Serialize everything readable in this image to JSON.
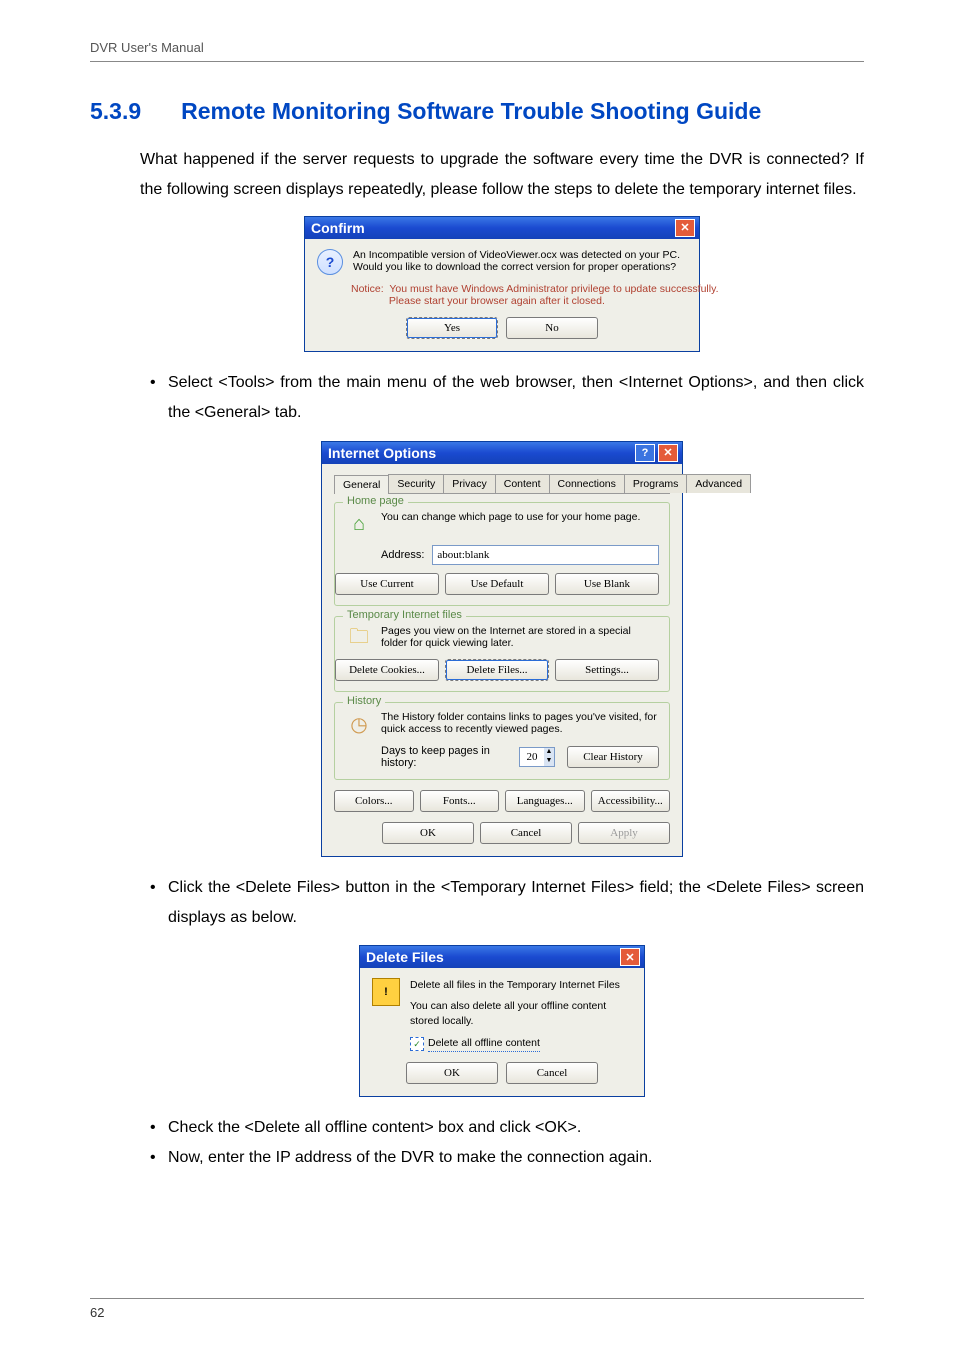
{
  "header": {
    "title": "DVR User's Manual"
  },
  "footer": {
    "page": "62"
  },
  "section": {
    "number": "5.3.9",
    "title": "Remote Monitoring Software Trouble Shooting Guide",
    "intro": "What happened if the server requests to upgrade the software every time the DVR is connected? If the following screen displays repeatedly, please follow the steps to delete the temporary internet files."
  },
  "bullets": {
    "b1": "Select <Tools> from the main menu of the web browser, then <Internet Options>, and then click the <General> tab.",
    "b2": "Click the <Delete Files> button in the <Temporary Internet Files> field; the <Delete Files> screen displays as below.",
    "b3": "Check the <Delete all offline content> box and click <OK>.",
    "b4": "Now, enter the IP address of the DVR to make the connection again."
  },
  "confirm": {
    "title": "Confirm",
    "line1": "An Incompatible version of VideoViewer.ocx was detected on your PC.",
    "line2": "Would you like to download the correct version for proper operations?",
    "notice": "Notice:  You must have Windows Administrator privilege to update successfully.\n             Please start your browser again after it closed.",
    "yes": "Yes",
    "no": "No"
  },
  "io": {
    "title": "Internet Options",
    "tabs": [
      "General",
      "Security",
      "Privacy",
      "Content",
      "Connections",
      "Programs",
      "Advanced"
    ],
    "home": {
      "label": "Home page",
      "text": "You can change which page to use for your home page.",
      "addr_label": "Address:",
      "addr_value": "about:blank",
      "use_current": "Use Current",
      "use_default": "Use Default",
      "use_blank": "Use Blank"
    },
    "temp": {
      "label": "Temporary Internet files",
      "text": "Pages you view on the Internet are stored in a special folder for quick viewing later.",
      "delete_cookies": "Delete Cookies...",
      "delete_files": "Delete Files...",
      "settings": "Settings..."
    },
    "hist": {
      "label": "History",
      "text": "The History folder contains links to pages you've visited, for quick access to recently viewed pages.",
      "days_label": "Days to keep pages in history:",
      "days_value": "20",
      "clear": "Clear History"
    },
    "btns": {
      "colors": "Colors...",
      "fonts": "Fonts...",
      "languages": "Languages...",
      "accessibility": "Accessibility..."
    },
    "ok": "OK",
    "cancel": "Cancel",
    "apply": "Apply"
  },
  "del": {
    "title": "Delete Files",
    "l1": "Delete all files in the Temporary Internet Files",
    "l2": "You can also delete all your offline content stored locally.",
    "chk": "Delete all offline content",
    "ok": "OK",
    "cancel": "Cancel"
  }
}
